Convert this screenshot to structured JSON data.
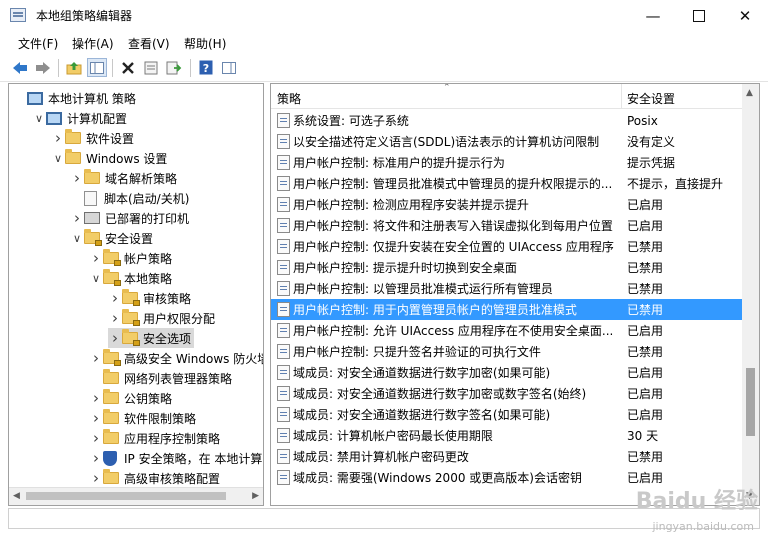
{
  "window": {
    "title": "本地组策略编辑器"
  },
  "menu": [
    "文件(F)",
    "操作(A)",
    "查看(V)",
    "帮助(H)"
  ],
  "tree": [
    {
      "label": "本地计算机 策略",
      "expander": "",
      "icon": "computer",
      "indent": 0,
      "selected": false
    },
    {
      "label": "计算机配置",
      "expander": "v",
      "icon": "computer",
      "indent": 1,
      "selected": false
    },
    {
      "label": "软件设置",
      "expander": ">",
      "icon": "folder",
      "indent": 2,
      "selected": false
    },
    {
      "label": "Windows 设置",
      "expander": "v",
      "icon": "folder",
      "indent": 2,
      "selected": false
    },
    {
      "label": "域名解析策略",
      "expander": ">",
      "icon": "folder",
      "indent": 3,
      "selected": false
    },
    {
      "label": "脚本(启动/关机)",
      "expander": "",
      "icon": "doc",
      "indent": 3,
      "selected": false
    },
    {
      "label": "已部署的打印机",
      "expander": ">",
      "icon": "printer",
      "indent": 3,
      "selected": false
    },
    {
      "label": "安全设置",
      "expander": "v",
      "icon": "lockfolder",
      "indent": 3,
      "selected": false
    },
    {
      "label": "帐户策略",
      "expander": ">",
      "icon": "lockfolder",
      "indent": 4,
      "selected": false
    },
    {
      "label": "本地策略",
      "expander": "v",
      "icon": "lockfolder",
      "indent": 4,
      "selected": false
    },
    {
      "label": "审核策略",
      "expander": ">",
      "icon": "lockfolder",
      "indent": 5,
      "selected": false
    },
    {
      "label": "用户权限分配",
      "expander": ">",
      "icon": "lockfolder",
      "indent": 5,
      "selected": false
    },
    {
      "label": "安全选项",
      "expander": ">",
      "icon": "lockfolder",
      "indent": 5,
      "selected": true
    },
    {
      "label": "高级安全 Windows 防火墙",
      "expander": ">",
      "icon": "lockfolder",
      "indent": 4,
      "selected": false
    },
    {
      "label": "网络列表管理器策略",
      "expander": "",
      "icon": "folder",
      "indent": 4,
      "selected": false
    },
    {
      "label": "公钥策略",
      "expander": ">",
      "icon": "folder",
      "indent": 4,
      "selected": false
    },
    {
      "label": "软件限制策略",
      "expander": ">",
      "icon": "folder",
      "indent": 4,
      "selected": false
    },
    {
      "label": "应用程序控制策略",
      "expander": ">",
      "icon": "folder",
      "indent": 4,
      "selected": false
    },
    {
      "label": "IP 安全策略，在 本地计算",
      "expander": ">",
      "icon": "shield",
      "indent": 4,
      "selected": false
    },
    {
      "label": "高级审核策略配置",
      "expander": ">",
      "icon": "folder",
      "indent": 4,
      "selected": false
    }
  ],
  "list": {
    "columns": [
      "策略",
      "安全设置"
    ],
    "rows": [
      {
        "name": "系统设置: 可选子系统",
        "value": "Posix"
      },
      {
        "name": "以安全描述符定义语言(SDDL)语法表示的计算机访问限制",
        "value": "没有定义"
      },
      {
        "name": "用户帐户控制: 标准用户的提升提示行为",
        "value": "提示凭据"
      },
      {
        "name": "用户帐户控制: 管理员批准模式中管理员的提升权限提示的...",
        "value": "不提示，直接提升"
      },
      {
        "name": "用户帐户控制: 检测应用程序安装并提示提升",
        "value": "已启用"
      },
      {
        "name": "用户帐户控制: 将文件和注册表写入错误虚拟化到每用户位置",
        "value": "已启用"
      },
      {
        "name": "用户帐户控制: 仅提升安装在安全位置的 UIAccess 应用程序",
        "value": "已禁用"
      },
      {
        "name": "用户帐户控制: 提示提升时切换到安全桌面",
        "value": "已禁用"
      },
      {
        "name": "用户帐户控制: 以管理员批准模式运行所有管理员",
        "value": "已禁用"
      },
      {
        "name": "用户帐户控制: 用于内置管理员帐户的管理员批准模式",
        "value": "已禁用"
      },
      {
        "name": "用户帐户控制: 允许 UIAccess 应用程序在不使用安全桌面...",
        "value": "已启用"
      },
      {
        "name": "用户帐户控制: 只提升签名并验证的可执行文件",
        "value": "已禁用"
      },
      {
        "name": "域成员: 对安全通道数据进行数字加密(如果可能)",
        "value": "已启用"
      },
      {
        "name": "域成员: 对安全通道数据进行数字加密或数字签名(始终)",
        "value": "已启用"
      },
      {
        "name": "域成员: 对安全通道数据进行数字签名(如果可能)",
        "value": "已启用"
      },
      {
        "name": "域成员: 计算机帐户密码最长使用期限",
        "value": "30 天"
      },
      {
        "name": "域成员: 禁用计算机帐户密码更改",
        "value": "已禁用"
      },
      {
        "name": "域成员: 需要强(Windows 2000 或更高版本)会话密钥",
        "value": "已启用"
      }
    ],
    "selected_index": 9
  },
  "watermark": {
    "main": "Baidu 经验",
    "sub": "jingyan.baidu.com"
  },
  "colors": {
    "selection": "#3399ff",
    "folder": "#f2cd68",
    "back_arrow": "#2f77c9"
  }
}
